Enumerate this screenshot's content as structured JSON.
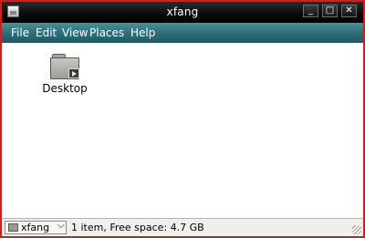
{
  "window": {
    "title": "xfang",
    "controls": {
      "minimize": "_",
      "maximize": "□",
      "close": "✕"
    }
  },
  "menu": {
    "file": "File",
    "edit": "Edit",
    "view": "View",
    "places": "Places",
    "help": "Help"
  },
  "content": {
    "items": [
      {
        "label": "Desktop",
        "icon": "folder-icon"
      }
    ]
  },
  "statusbar": {
    "path": "xfang",
    "path_arrow": "⌵",
    "text": "1 item, Free space: 4.7 GB"
  },
  "colors": {
    "border": "#e01818",
    "menubar": "#2c6f7a",
    "titlebar": "#0c0c0c"
  }
}
